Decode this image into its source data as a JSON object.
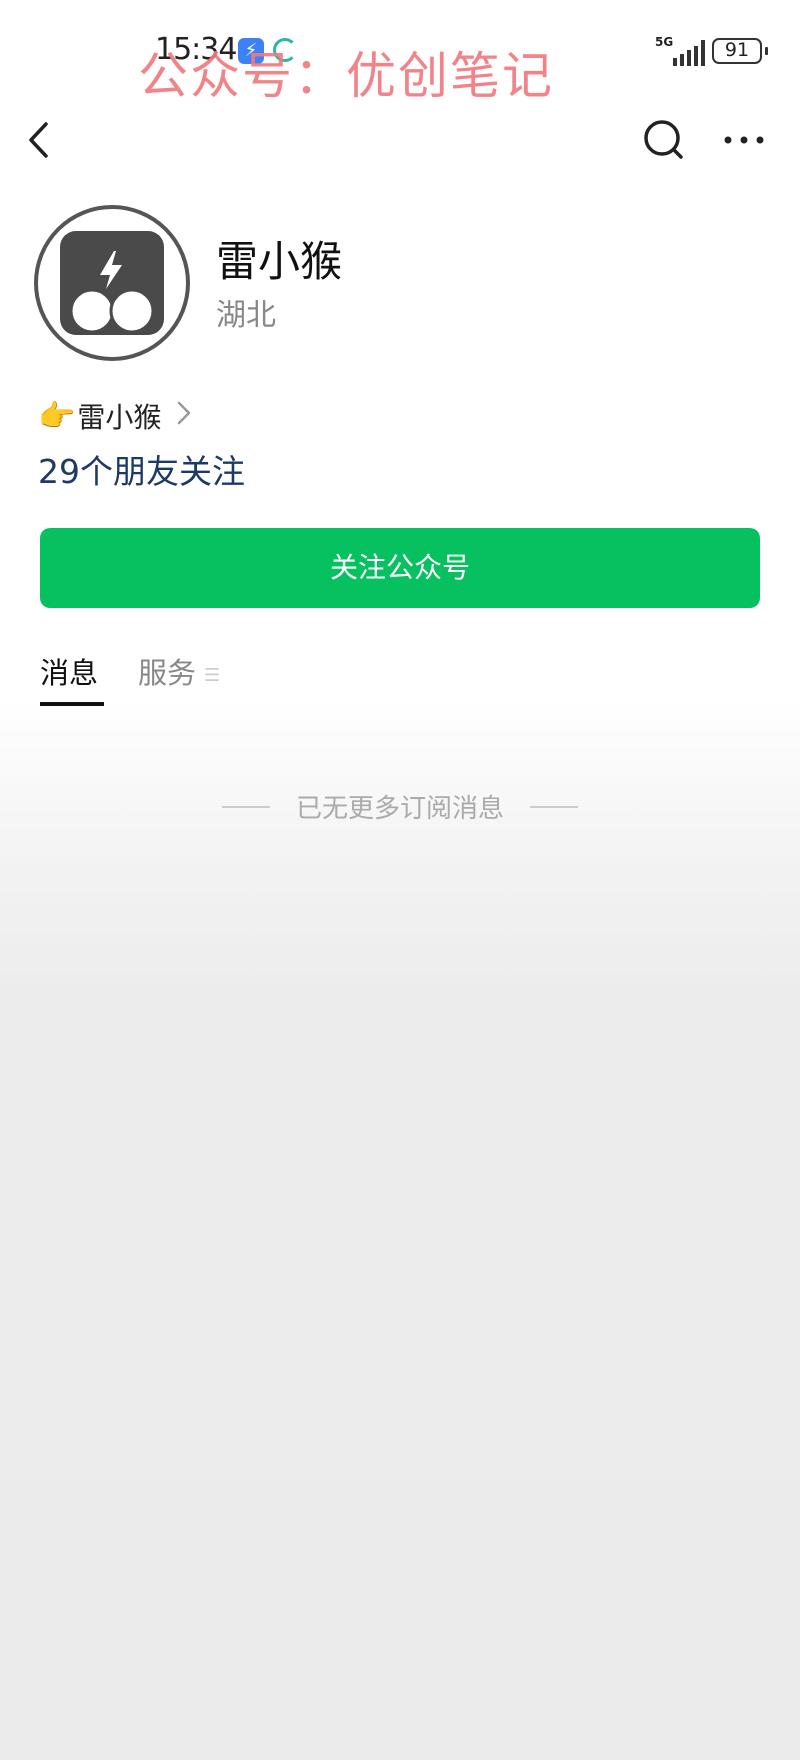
{
  "status_bar": {
    "time": "15:34",
    "network": "5G",
    "battery": "91"
  },
  "watermark": "公众号：优创笔记",
  "nav": {
    "back_icon": "chevron-left-icon",
    "search_icon": "search-icon",
    "more_icon": "more-dots-icon"
  },
  "profile": {
    "name": "雷小猴",
    "region": "湖北",
    "related_account": "雷小猴",
    "related_emoji": "👉",
    "friends_following": "29个朋友关注"
  },
  "follow_button": "关注公众号",
  "tabs": {
    "messages": "消息",
    "services": "服务"
  },
  "end_message": "已无更多订阅消息",
  "colors": {
    "primary_green": "#07c160",
    "link_blue": "#1d3a66",
    "watermark_red": "#f07a80"
  }
}
